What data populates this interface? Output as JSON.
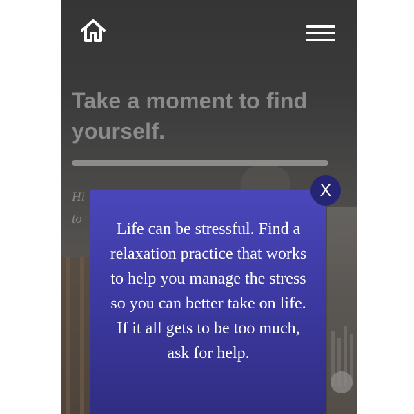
{
  "header": {
    "home_icon": "home-icon",
    "menu_icon": "hamburger-menu-icon"
  },
  "hero": {
    "title": "Take a moment to find yourself.",
    "progress": 1.0,
    "partial_text": "Hi\nto"
  },
  "modal": {
    "message": "Life can be stressful. Find a relaxation practice that works to help you manage the stress so you can better take on life. If it all gets to be too much, ask for help.",
    "close_label": "X"
  },
  "colors": {
    "page_background": "#ffffff",
    "phone_background": "#3b3b3b",
    "modal_background": "#4341ad",
    "close_button": "#262573",
    "title_text": "#8b8b8b"
  }
}
